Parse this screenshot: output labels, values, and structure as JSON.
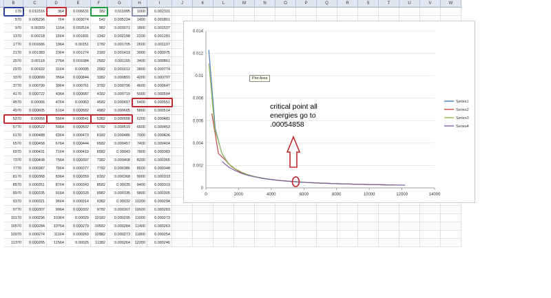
{
  "spreadsheet": {
    "columns": [
      "B",
      "C",
      "D",
      "E",
      "F",
      "G",
      "H",
      "I",
      "J",
      "K",
      "L",
      "M",
      "N",
      "O",
      "P",
      "Q",
      "R",
      "S",
      "T",
      "U",
      "V",
      "W"
    ],
    "rows": [
      [
        "179",
        "0.012316",
        "364",
        "0.006631",
        "182",
        "0.011095",
        "1000",
        "0.002331"
      ],
      [
        "570",
        "0.005296",
        "764",
        "0.003074",
        "542",
        "0.005234",
        "1400",
        "0.001851"
      ],
      [
        "970",
        "0.00309",
        "1164",
        "0.002514",
        "982",
        "0.003071",
        "1800",
        "0.001537"
      ],
      [
        "1370",
        "0.00218",
        "1564",
        "0.001891",
        "1342",
        "0.002198",
        "2200",
        "0.001281"
      ],
      [
        "1770",
        "0.001686",
        "1964",
        "0.00151",
        "1782",
        "0.001705",
        "2600",
        "0.001107"
      ],
      [
        "2170",
        "0.001383",
        "2364",
        "0.001274",
        "2182",
        "0.001413",
        "3000",
        "0.000975"
      ],
      [
        "2570",
        "0.00118",
        "2764",
        "0.001084",
        "2582",
        "0.001165",
        "3400",
        "0.000861"
      ],
      [
        "2970",
        "0.00102",
        "3164",
        "0.00095",
        "2982",
        "0.001012",
        "3800",
        "0.000774"
      ],
      [
        "3370",
        "0.000899",
        "3564",
        "0.000844",
        "3382",
        "0.000891",
        "4200",
        "0.000707"
      ],
      [
        "3770",
        "0.000799",
        "3964",
        "0.000761",
        "3782",
        "0.000796",
        "4600",
        "0.000647"
      ],
      [
        "4170",
        "0.000722",
        "4364",
        "0.000687",
        "4182",
        "0.000719",
        "5000",
        "0.000594"
      ],
      [
        "4570",
        "0.00066",
        "4764",
        "0.00063",
        "4582",
        "0.000657",
        "5400",
        "0.000551"
      ],
      [
        "4970",
        "0.000605",
        "5164",
        "0.000582",
        "4982",
        "0.000605",
        "5800",
        "0.000514"
      ],
      [
        "5370",
        "0.00056",
        "5564",
        "0.000541",
        "5382",
        "0.000558",
        "6200",
        "0.000481"
      ],
      [
        "5770",
        "0.000522",
        "5964",
        "0.000502",
        "5782",
        "0.000519",
        "6600",
        "0.000453"
      ],
      [
        "6170",
        "0.000488",
        "6364",
        "0.000473",
        "6182",
        "0.000486",
        "7000",
        "0.000426"
      ],
      [
        "6570",
        "0.000458",
        "6764",
        "0.000444",
        "6582",
        "0.000457",
        "7400",
        "0.000404"
      ],
      [
        "6970",
        "0.000431",
        "7164",
        "0.000419",
        "6982",
        "0.00043",
        "7800",
        "0.000383"
      ],
      [
        "7370",
        "0.000408",
        "7564",
        "0.000397",
        "7382",
        "0.000408",
        "8200",
        "0.000365"
      ],
      [
        "7770",
        "0.000387",
        "7964",
        "0.000377",
        "7782",
        "0.000386",
        "8600",
        "0.000348"
      ],
      [
        "8170",
        "0.000368",
        "8364",
        "0.000359",
        "8182",
        "0.000368",
        "9000",
        "0.000333"
      ],
      [
        "8570",
        "0.000351",
        "8764",
        "0.000343",
        "8582",
        "0.00035",
        "9400",
        "0.000319"
      ],
      [
        "8970",
        "0.000335",
        "9164",
        "0.000328",
        "8982",
        "0.000335",
        "9800",
        "0.000305"
      ],
      [
        "9370",
        "0.000321",
        "9564",
        "0.000314",
        "9382",
        "0.00032",
        "10200",
        "0.000294"
      ],
      [
        "9770",
        "0.000307",
        "9964",
        "0.000302",
        "9782",
        "0.000307",
        "10600",
        "0.000283"
      ],
      [
        "10170",
        "0.000296",
        "10364",
        "0.00029",
        "10182",
        "0.000295",
        "11000",
        "0.000273"
      ],
      [
        "10570",
        "0.000284",
        "10764",
        "0.000279",
        "10582",
        "0.000284",
        "11400",
        "0.000263"
      ],
      [
        "10970",
        "0.000274",
        "11164",
        "0.000269",
        "10982",
        "0.000273",
        "11800",
        "0.000254"
      ],
      [
        "11370",
        "0.000265",
        "11564",
        "0.00026",
        "11382",
        "0.000264",
        "12200",
        "0.000246"
      ]
    ]
  },
  "chart_data": {
    "type": "line",
    "xlim": [
      0,
      14000
    ],
    "ylim": [
      0,
      0.014
    ],
    "x_ticks": [
      "0",
      "2000",
      "4000",
      "6000",
      "8000",
      "10000",
      "12000",
      "14000"
    ],
    "y_ticks": [
      "0",
      "0.002",
      "0.004",
      "0.006",
      "0.008",
      "0.01",
      "0.012",
      "0.014"
    ],
    "grid": true,
    "legend_position": "right",
    "series": [
      {
        "name": "Series1",
        "color": "#4a7ebb",
        "x": [
          179,
          570,
          970,
          1370,
          1770,
          2170,
          2570,
          2970,
          3370,
          3770,
          4170,
          4570,
          4970,
          5370,
          5770,
          6170,
          6570,
          6970,
          7370,
          7770,
          8170,
          8570,
          8970,
          9370,
          9770,
          10170,
          10570,
          10970,
          11370
        ],
        "y": [
          0.012316,
          0.005296,
          0.00309,
          0.00218,
          0.001686,
          0.001383,
          0.00118,
          0.00102,
          0.000899,
          0.000799,
          0.000722,
          0.00066,
          0.000605,
          0.00056,
          0.000522,
          0.000488,
          0.000458,
          0.000431,
          0.000408,
          0.000387,
          0.000368,
          0.000351,
          0.000335,
          0.000321,
          0.000307,
          0.000296,
          0.000284,
          0.000274,
          0.000265
        ]
      },
      {
        "name": "Series2",
        "color": "#be4b48",
        "x": [
          364,
          764,
          1164,
          1564,
          1964,
          2364,
          2764,
          3164,
          3564,
          3964,
          4364,
          4764,
          5164,
          5564,
          5964,
          6364,
          6764,
          7164,
          7564,
          7964,
          8364,
          8764,
          9164,
          9564,
          9964,
          10364,
          10764,
          11164,
          11564
        ],
        "y": [
          0.006631,
          0.003074,
          0.002514,
          0.001891,
          0.00151,
          0.001274,
          0.001084,
          0.00095,
          0.000844,
          0.000761,
          0.000687,
          0.00063,
          0.000582,
          0.000541,
          0.000502,
          0.000473,
          0.000444,
          0.000419,
          0.000397,
          0.000377,
          0.000359,
          0.000343,
          0.000328,
          0.000314,
          0.000302,
          0.00029,
          0.000279,
          0.000269,
          0.00026
        ]
      },
      {
        "name": "Series3",
        "color": "#98b954",
        "x": [
          182,
          542,
          982,
          1342,
          1782,
          2182,
          2582,
          2982,
          3382,
          3782,
          4182,
          4582,
          4982,
          5382,
          5782,
          6182,
          6582,
          6982,
          7382,
          7782,
          8182,
          8582,
          8982,
          9382,
          9782,
          10182,
          10582,
          10982,
          11382
        ],
        "y": [
          0.011095,
          0.005234,
          0.003071,
          0.002198,
          0.001705,
          0.001413,
          0.001165,
          0.001012,
          0.000891,
          0.000796,
          0.000719,
          0.000657,
          0.000605,
          0.000558,
          0.000519,
          0.000486,
          0.000457,
          0.00043,
          0.000408,
          0.000386,
          0.000368,
          0.00035,
          0.000335,
          0.00032,
          0.000307,
          0.000295,
          0.000284,
          0.000273,
          0.000264
        ]
      },
      {
        "name": "Series4",
        "color": "#7d60a0",
        "x": [
          1000,
          1400,
          1800,
          2200,
          2600,
          3000,
          3400,
          3800,
          4200,
          4600,
          5000,
          5400,
          5800,
          6200,
          6600,
          7000,
          7400,
          7800,
          8200,
          8600,
          9000,
          9400,
          9800,
          10200,
          10600,
          11000,
          11400,
          11800,
          12200
        ],
        "y": [
          0.002331,
          0.001851,
          0.001537,
          0.001281,
          0.001107,
          0.000975,
          0.000861,
          0.000774,
          0.000707,
          0.000647,
          0.000594,
          0.000551,
          0.000514,
          0.000481,
          0.000453,
          0.000426,
          0.000404,
          0.000383,
          0.000365,
          0.000348,
          0.000333,
          0.000319,
          0.000305,
          0.000294,
          0.000283,
          0.000273,
          0.000263,
          0.000254,
          0.000246
        ]
      }
    ],
    "annotation": "critical point all energies go to .00054858",
    "tooltip": "Plot Area",
    "highlight_colors": {
      "blue": "#2a3f9a",
      "red": "#c0282e",
      "green": "#1c9a3a",
      "gray": "#8a8fa8"
    }
  }
}
